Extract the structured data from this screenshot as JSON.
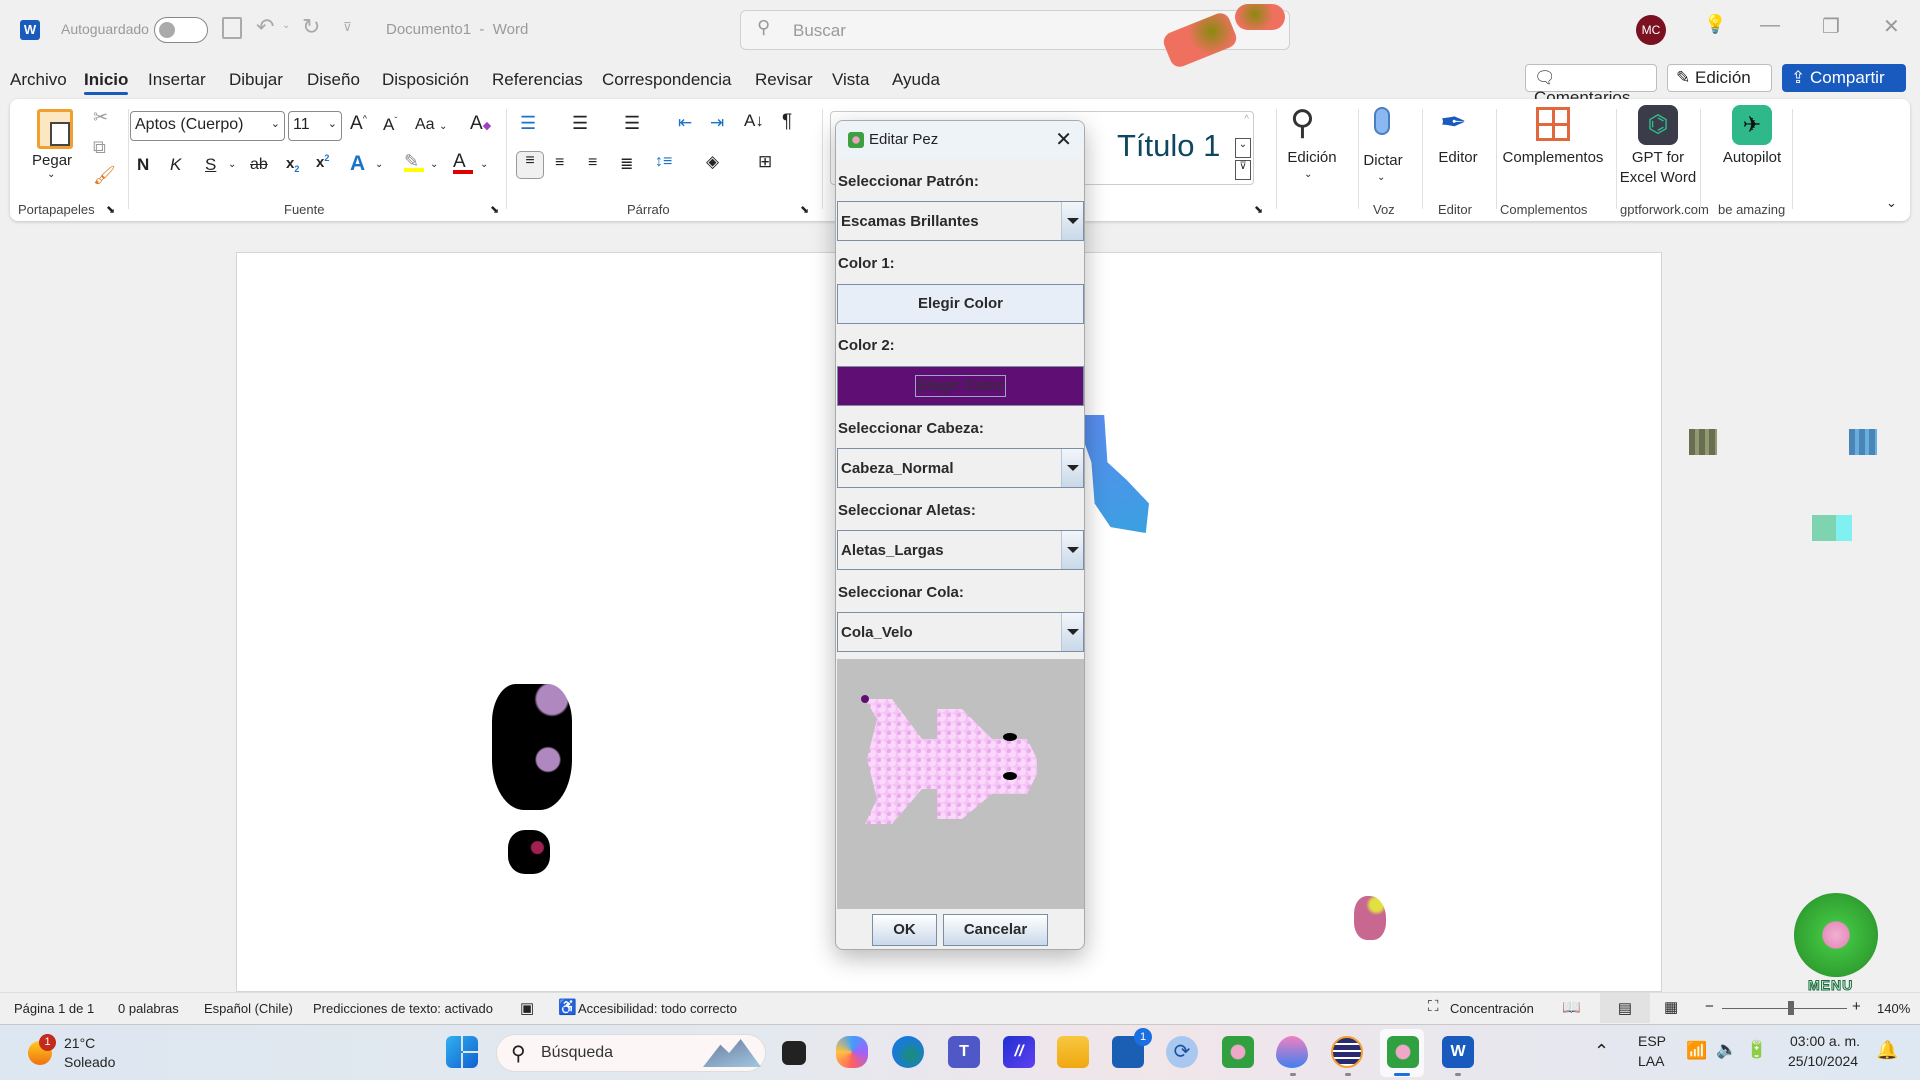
{
  "titlebar": {
    "autosave_label": "Autoguardado",
    "doc_title": "Documento1  -  Word",
    "search_placeholder": "Buscar",
    "avatar_initials": "MC"
  },
  "menubar": {
    "items": [
      "Archivo",
      "Inicio",
      "Insertar",
      "Dibujar",
      "Diseño",
      "Disposición",
      "Referencias",
      "Correspondencia",
      "Revisar",
      "Vista",
      "Ayuda"
    ],
    "active": "Inicio",
    "comments_label": "Comentarios",
    "editing_label": "Edición",
    "share_label": "Compartir"
  },
  "ribbon": {
    "clipboard": {
      "paste_label": "Pegar",
      "group_label": "Portapapeles"
    },
    "font": {
      "font_name": "Aptos (Cuerpo)",
      "font_size": "11",
      "case_label": "Aa",
      "bold": "N",
      "italic": "K",
      "underline": "S",
      "strike": "ab",
      "group_label": "Fuente",
      "highlight_color": "#ffff00",
      "font_color": "#e00000"
    },
    "paragraph": {
      "group_label": "Párrafo"
    },
    "styles": {
      "visible_style": "Título 1"
    },
    "editing": {
      "label": "Edición"
    },
    "voice": {
      "label": "Dictar",
      "group_label": "Voz"
    },
    "editor": {
      "label": "Editor",
      "group_label": "Editor"
    },
    "addins": {
      "label": "Complementos",
      "group_label": "Complementos"
    },
    "gpt": {
      "label_line1": "GPT for",
      "label_line2": "Excel Word",
      "group_label": "gptforwork.com"
    },
    "autopilot": {
      "label": "Autopilot",
      "group_label": "be amazing"
    }
  },
  "dialog": {
    "title": "Editar Pez",
    "pattern_label": "Seleccionar Patrón:",
    "pattern_value": "Escamas Brillantes",
    "color1_label": "Color 1:",
    "color1_button": "Elegir Color",
    "color2_label": "Color 2:",
    "color2_button": "Elegir Color",
    "color2_value": "#5f0f73",
    "head_label": "Seleccionar Cabeza:",
    "head_value": "Cabeza_Normal",
    "fins_label": "Seleccionar Aletas:",
    "fins_value": "Aletas_Largas",
    "tail_label": "Seleccionar Cola:",
    "tail_value": "Cola_Velo",
    "ok_label": "OK",
    "cancel_label": "Cancelar"
  },
  "overlay": {
    "menu_label": "MENU"
  },
  "statusbar": {
    "page": "Página 1 de 1",
    "words": "0 palabras",
    "language": "Español (Chile)",
    "predictions": "Predicciones de texto: activado",
    "accessibility": "Accesibilidad: todo correcto",
    "focus": "Concentración",
    "zoom": "140%",
    "zoom_percent": 140
  },
  "taskbar": {
    "weather_temp": "21°C",
    "weather_desc": "Soleado",
    "weather_badge": "1",
    "search_placeholder": "Búsqueda",
    "store_badge": "1",
    "lang_line1": "ESP",
    "lang_line2": "LAA",
    "time": "03:00 a. m.",
    "date": "25/10/2024"
  }
}
